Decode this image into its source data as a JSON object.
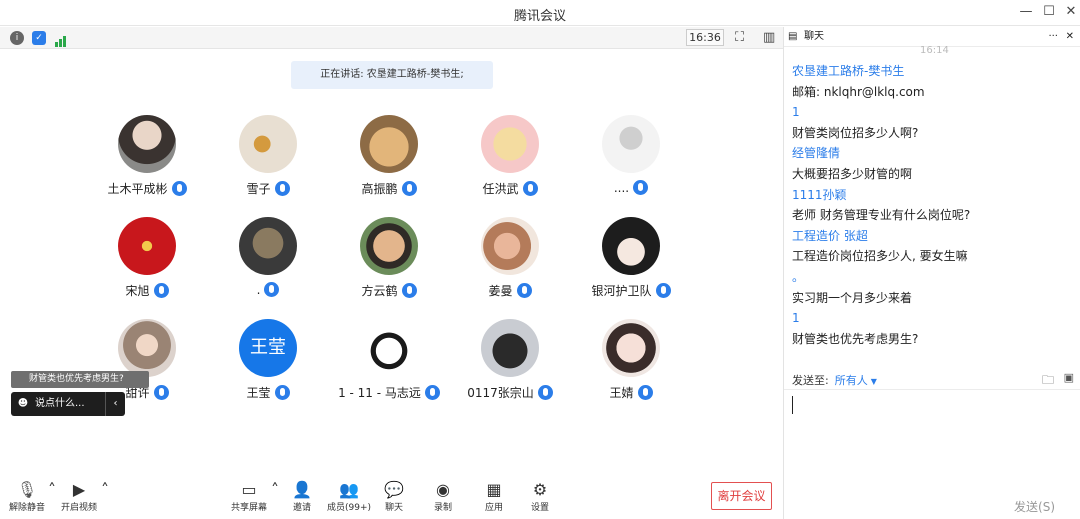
{
  "window": {
    "title": "腾讯会议"
  },
  "toolbar": {
    "time": "16:36"
  },
  "main": {
    "speaking_label": "正在讲话: 农垦建工路桥-樊书生;",
    "participants": [
      {
        "name": "土木平成彬"
      },
      {
        "name": "雪子"
      },
      {
        "name": "高振鹏"
      },
      {
        "name": "任洪武"
      },
      {
        "name": "...."
      },
      {
        "name": "宋旭"
      },
      {
        "name": "."
      },
      {
        "name": "方云鹤"
      },
      {
        "name": "姜曼"
      },
      {
        "name": "银河护卫队"
      },
      {
        "name": "甜许"
      },
      {
        "name": "王莹",
        "avatar_text": "王莹"
      },
      {
        "name": "1 - 11 - 马志远"
      },
      {
        "name": "0117张宗山"
      },
      {
        "name": "王婧"
      }
    ],
    "chat_popup": "财管类也优先考虑男生?",
    "say_placeholder": "说点什么..."
  },
  "bottom": {
    "unmute": "解除静音",
    "video": "开启视频",
    "share": "共享屏幕",
    "invite": "邀请",
    "members": "成员(99+)",
    "chat": "聊天",
    "record": "录制",
    "apps": "应用",
    "settings": "设置",
    "leave": "离开会议"
  },
  "sidebar": {
    "title": "聊天",
    "time": "16:14",
    "messages": [
      {
        "text": "农垦建工路桥-樊书生",
        "sender": true
      },
      {
        "text": "邮箱: nklqhr@lklq.com",
        "sender": false
      },
      {
        "text": "1",
        "sender": true
      },
      {
        "text": "财管类岗位招多少人啊?",
        "sender": false
      },
      {
        "text": "经管隆倩",
        "sender": true
      },
      {
        "text": "大概要招多少财管的啊",
        "sender": false
      },
      {
        "text": "1111孙颖",
        "sender": true
      },
      {
        "text": "老师  财务管理专业有什么岗位呢?",
        "sender": false
      },
      {
        "text": "工程造价 张超",
        "sender": true
      },
      {
        "text": "工程造价岗位招多少人, 要女生嘛",
        "sender": false
      },
      {
        "text": "。",
        "sender": true
      },
      {
        "text": "实习期一个月多少来着",
        "sender": false
      },
      {
        "text": "1",
        "sender": true
      },
      {
        "text": "财管类也优先考虑男生?",
        "sender": false
      }
    ],
    "send_to_label": "发送至:",
    "send_to_value": "所有人",
    "send_button": "发送(S)"
  },
  "colors": {
    "accent": "#2b7de9",
    "leave": "#e04040"
  }
}
